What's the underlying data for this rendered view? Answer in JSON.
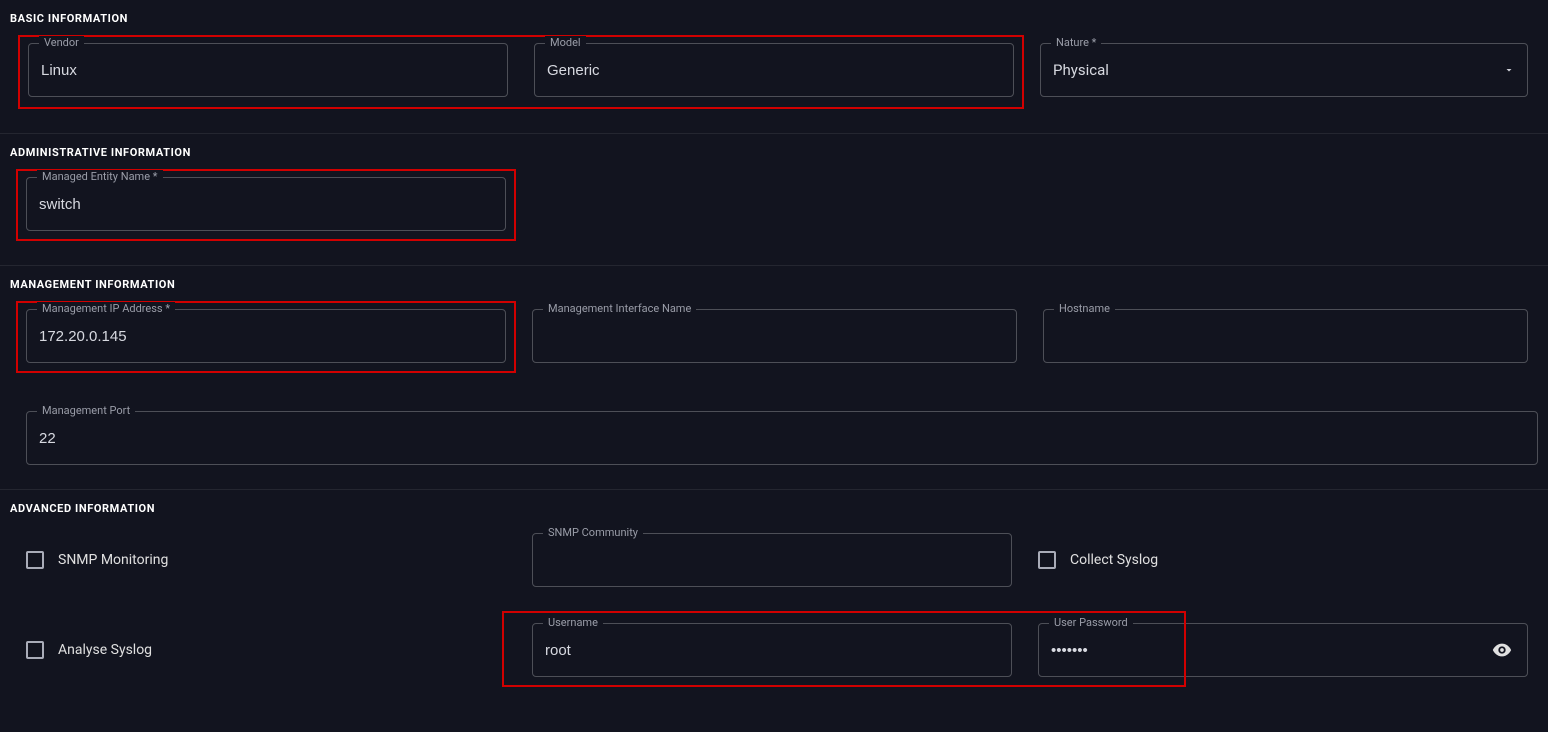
{
  "sections": {
    "basic": {
      "title": "BASIC INFORMATION",
      "vendor": {
        "label": "Vendor",
        "value": "Linux"
      },
      "model": {
        "label": "Model",
        "value": "Generic"
      },
      "nature": {
        "label": "Nature *",
        "value": "Physical"
      }
    },
    "admin": {
      "title": "ADMINISTRATIVE INFORMATION",
      "entity_name": {
        "label": "Managed Entity Name *",
        "value": "switch"
      }
    },
    "mgmt": {
      "title": "MANAGEMENT INFORMATION",
      "ip": {
        "label": "Management IP Address *",
        "value": "172.20.0.145"
      },
      "iface": {
        "label": "Management Interface Name",
        "value": ""
      },
      "hostname": {
        "label": "Hostname",
        "value": ""
      },
      "port": {
        "label": "Management Port",
        "value": "22"
      }
    },
    "advanced": {
      "title": "ADVANCED INFORMATION",
      "snmp_monitoring": {
        "label": "SNMP Monitoring",
        "checked": false
      },
      "snmp_community": {
        "label": "SNMP Community",
        "value": ""
      },
      "collect_syslog": {
        "label": "Collect Syslog",
        "checked": false
      },
      "analyse_syslog": {
        "label": "Analyse Syslog",
        "checked": false
      },
      "username": {
        "label": "Username",
        "value": "root"
      },
      "password": {
        "label": "User Password",
        "value": "•••••••"
      }
    }
  }
}
